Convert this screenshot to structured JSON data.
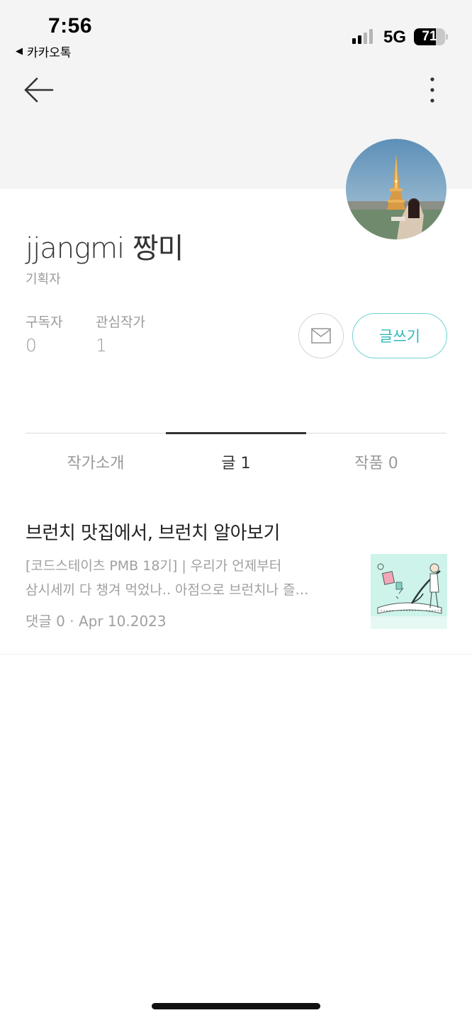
{
  "status_bar": {
    "time": "7:56",
    "back_app": "카카오톡",
    "network": "5G",
    "battery": "71",
    "battery_level": 0.71
  },
  "nav": {
    "back_icon": "arrow-left-icon",
    "more_icon": "vertical-dots-icon"
  },
  "profile": {
    "name": "jjangmi 짱미",
    "role": "기획자",
    "subscribers_label": "구독자",
    "subscribers_value": "0",
    "following_label": "관심작가",
    "following_value": "1",
    "mail_icon": "envelope-icon",
    "write_label": "글쓰기"
  },
  "tabs": [
    {
      "label": "작가소개",
      "active": false
    },
    {
      "label": "글 1",
      "active": true
    },
    {
      "label": "작품 0",
      "active": false
    }
  ],
  "posts": [
    {
      "title": "브런치 맛집에서, 브런치 알아보기",
      "excerpt_line1": "[코드스테이츠 PMB 18기] | 우리가 언제부터",
      "excerpt_line2": "삼시세끼 다 챙겨 먹었나.. 아점으로 브런치나 즐…",
      "meta": "댓글 0 · Apr 10.2023"
    }
  ],
  "colors": {
    "accent": "#2fb9bd",
    "header_bg": "#f4f4f4",
    "muted_text": "#9a9a9a"
  }
}
